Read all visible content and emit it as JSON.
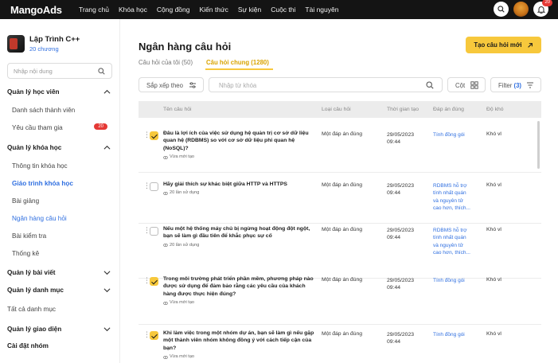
{
  "nav": {
    "logo": "MangoAds",
    "items": [
      "Trang chủ",
      "Khóa học",
      "Cộng đồng",
      "Kiến thức",
      "Sự kiện",
      "Cuộc thi",
      "Tài nguyên"
    ],
    "notification_count": "20"
  },
  "sidebar": {
    "course_title": "Lập Trình C++",
    "course_subtitle": "20 chương",
    "search_placeholder": "Nhập nội dung",
    "sections": {
      "students": "Quản lý học viên",
      "student_list": "Danh sách thành viên",
      "join_requests": "Yêu cầu tham gia",
      "join_requests_count": "20",
      "courses": "Quản lý khóa học",
      "course_info": "Thông tin khóa học",
      "course_curriculum": "Giáo trình khóa học",
      "lectures": "Bài giảng",
      "question_bank": "Ngân hàng câu hỏi",
      "tests": "Bài kiểm tra",
      "statistics": "Thống kê",
      "posts": "Quản lý bài viết",
      "categories": "Quản lý danh mục",
      "all_categories": "Tất cả danh mục",
      "interface": "Quản lý giao diện",
      "settings": "Cài đặt nhóm"
    }
  },
  "main": {
    "title": "Ngân hàng câu hỏi",
    "create_button": "Tạo câu hỏi mới",
    "tabs": {
      "mine": "Câu hỏi của tôi (50)",
      "shared": "Câu hỏi chung (1280)"
    },
    "sort_label": "Sắp xếp theo",
    "search_placeholder": "Nhập từ khóa",
    "columns_button": "Cột",
    "filter_label": "Filter",
    "filter_count": "(3)",
    "table": {
      "headers": {
        "name": "Tên câu hỏi",
        "type": "Loại câu hỏi",
        "time": "Thời gian tạo",
        "answer": "Đáp án đúng",
        "difficulty": "Độ khó"
      },
      "rows": [
        {
          "question": "Đâu là lợi ích của việc sử dụng hệ quản trị cơ sở dữ liệu quan hệ (RDBMS) so với cơ sở dữ liệu phi quan hệ (NoSQL)?",
          "usage": "Vừa mới tạo",
          "type": "Một đáp án đúng",
          "date": "29/05/2023",
          "time": "09:44",
          "answer": "Tính đồng gói",
          "difficulty": "Khó vl",
          "checked": true
        },
        {
          "question": "Hãy giải thích sự khác biệt giữa HTTP và HTTPS",
          "usage": "20 lần sử dụng",
          "type": "Một đáp án đúng",
          "date": "29/05/2023",
          "time": "09:44",
          "answer": "RDBMS hỗ trợ tính nhất quán và nguyên tử cao hơn, thích...",
          "difficulty": "Khó vl",
          "checked": false
        },
        {
          "question": "Nếu một hệ thống máy chủ bị ngừng hoạt động đột ngột, bạn sẽ làm gì đầu tiên để khắc phục sự cố",
          "usage": "20 lần sử dụng",
          "type": "Một đáp án đúng",
          "date": "29/05/2023",
          "time": "09:44",
          "answer": "RDBMS hỗ trợ tính nhất quán và nguyên tử cao hơn, thích...",
          "difficulty": "Khó vl",
          "checked": false
        },
        {
          "question": "Trong môi trường phát triển phần mềm, phương pháp nào được sử dụng để đảm bảo rằng các yêu cầu của khách hàng được thực hiện đúng?",
          "usage": "Vừa mới tạo",
          "type": "Một đáp án đúng",
          "date": "29/05/2023",
          "time": "09:44",
          "answer": "Tính đồng gói",
          "difficulty": "Khó vl",
          "checked": true
        },
        {
          "question": "Khi làm việc trong một nhóm dự án, bạn sẽ làm gì nếu gặp một thành viên nhóm không đồng ý với cách tiếp cận của bạn?",
          "usage": "Vừa mới tạo",
          "type": "Một đáp án đúng",
          "date": "29/05/2023",
          "time": "09:44",
          "answer": "Tính đồng gói",
          "difficulty": "Khó vl",
          "checked": true
        }
      ]
    }
  },
  "colors": {
    "accent": "#f7c83c",
    "link": "#2f6fe0",
    "badge": "#e53935",
    "topbar": "#141414"
  }
}
